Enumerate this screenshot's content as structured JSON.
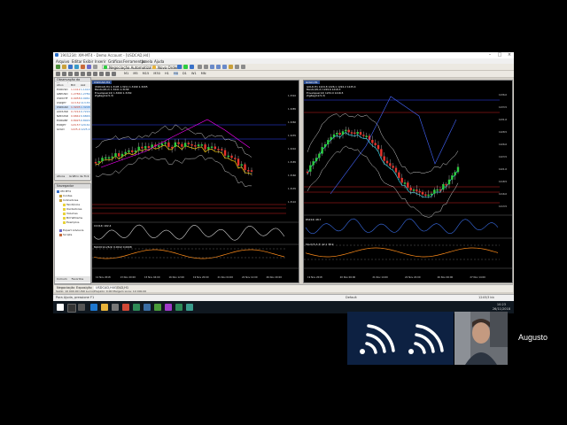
{
  "window": {
    "title": "1901234: XM-MT4 - Demo Account - [USDCAD,H4]"
  },
  "menu": [
    "Arquivo",
    "Editar",
    "Exibir",
    "Inserir",
    "Gráficos",
    "Ferramentas",
    "Janela",
    "Ajuda"
  ],
  "toolbar": {
    "autotrade_label": "Negociação Automatizada",
    "new_order_label": "Nova Ordem",
    "timeframes": [
      "M1",
      "M5",
      "M15",
      "M30",
      "H1",
      "H4",
      "D1",
      "W1",
      "MN"
    ]
  },
  "market_watch": {
    "title": "Observação do Mercado",
    "col_symbol": "Ativo",
    "col_bid": "Bid",
    "col_ask": "Ask",
    "rows": [
      {
        "s": "EURUSD",
        "b": "1.1412",
        "a": "1.1414"
      },
      {
        "s": "GBPUSD",
        "b": "1.2786",
        "a": "1.2789"
      },
      {
        "s": "USDCHF",
        "b": "0.9958",
        "a": "0.9961"
      },
      {
        "s": "USDJPY",
        "b": "113.52",
        "a": "113.55"
      },
      {
        "s": "USDCAD",
        "b": "1.3205",
        "a": "1.3208"
      },
      {
        "s": "AUDUSD",
        "b": "0.7214",
        "a": "0.7216"
      },
      {
        "s": "NZDUSD",
        "b": "0.6842",
        "a": "0.6846"
      },
      {
        "s": "EURGBP",
        "b": "0.8925",
        "a": "0.8929"
      },
      {
        "s": "EURJPY",
        "b": "129.57",
        "a": "129.61"
      },
      {
        "s": "GOLD",
        "b": "1225.4",
        "a": "1225.9"
      }
    ],
    "tabs": [
      "Ativos",
      "Gráfico de Tick"
    ]
  },
  "navigator": {
    "title": "Navegador",
    "items": [
      "XM MT4",
      "Contas",
      "Indicadores",
      "Tendência",
      "Osciladores",
      "Volumes",
      "Bill Williams",
      "Exemplos",
      "Expert Advisors",
      "Scripts"
    ],
    "tabs": [
      "Comum",
      "Favoritos"
    ]
  },
  "chart_left": {
    "title": "USDCAD,H4",
    "info": [
      "USDCAD,H4 1.3195 1.3211 1.3190 1.3205",
      "Bands(20,2) 1.3241 1.3158",
      "Envelopes(14) 1.3260 1.3150",
      "ZigZag(12,5,3)"
    ],
    "yticks": [
      "1.3310",
      "1.3285",
      "1.3260",
      "1.3235",
      "1.3210",
      "1.3185",
      "1.3160",
      "1.3135",
      "1.3110"
    ],
    "xticks": [
      "12 Nov 2018",
      "13 Nov 20:00",
      "15 Nov 04:00",
      "16 Nov 12:00",
      "19 Nov 20:00",
      "21 Nov 04:00",
      "22 Nov 12:00",
      "26 Nov 20:00"
    ],
    "sub1": "CCI(14) 102.4",
    "sub2": "MACD(12,26,9) 0.0012 0.0008",
    "tab": "USDCAD,H4"
  },
  "chart_right": {
    "title": "GOLD,H1",
    "info": [
      "GOLD,H1 1224.8 1226.1 1224.2 1225.4",
      "Bands(20,2) 1229.6 1218.3",
      "Envelopes(14) 1232.0 1216.5",
      "ZigZag(12,5,3)"
    ],
    "yticks": [
      "1236.0",
      "1233.5",
      "1231.0",
      "1228.5",
      "1226.0",
      "1223.5",
      "1221.0",
      "1218.5",
      "1216.0",
      "1213.5"
    ],
    "xticks": [
      "19 Nov 2018",
      "20 Nov 06:00",
      "21 Nov 14:00",
      "22 Nov 22:00",
      "26 Nov 06:00",
      "27 Nov 14:00"
    ],
    "sub1": "RSI(14) 48.7",
    "sub2": "Stoch(5,3,3) 42.1 38.9",
    "tab": "GOLD,H1"
  },
  "terminal": {
    "tabs": [
      "Negociação",
      "Exposição",
      "Histórico da Conta"
    ],
    "line": "Saldo: 10 000.00 USD   Lucro/Prejuízo: 0.00   Margem Livre: 10 000.00"
  },
  "status": {
    "help": "Para Ajuda, pressione F1",
    "profile": "Default",
    "conn": "1245/3 kb"
  },
  "taskbar": {
    "time": "10:23",
    "date": "26/11/2018"
  },
  "call": {
    "name": "Augusto"
  },
  "colors": {
    "bull": "#2ecc40",
    "bear": "#e8332c",
    "ma": "#ffcc00",
    "band": "#d0d0d0",
    "zigzag": "#ff00ff",
    "aqua": "#33ccdd"
  }
}
